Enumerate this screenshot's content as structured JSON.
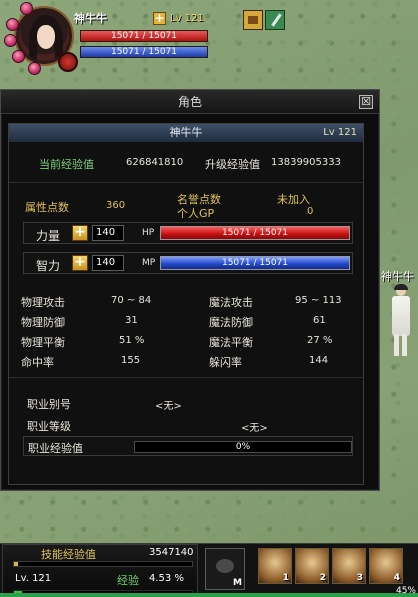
{
  "player": {
    "name": "神牛牛",
    "level": "Lv 121",
    "hp": "15071 / 15071",
    "mp": "15071 / 15071"
  },
  "panel": {
    "title": "角色",
    "close_glyph": "☒",
    "name": "神牛牛",
    "level": "Lv 121",
    "exp": {
      "current_label": "当前经验值",
      "current_value": "626841810",
      "upgrade_label": "升级经验值",
      "upgrade_value": "13839905333"
    },
    "points": {
      "attr_label": "属性点数",
      "attr_value": "360",
      "fame_label": "名誉点数",
      "fame_value": "未加入",
      "gp_label": "个人GP",
      "gp_value": "0"
    },
    "strength": {
      "label": "力量",
      "value": "140",
      "bar_label": "HP",
      "bar_value": "15071 / 15071"
    },
    "intelligence": {
      "label": "智力",
      "value": "140",
      "bar_label": "MP",
      "bar_value": "15071 / 15071"
    },
    "combat_stats": [
      {
        "label": "物理攻击",
        "value": "70 ~ 84",
        "label2": "魔法攻击",
        "value2": "95 ~ 113"
      },
      {
        "label": "物理防御",
        "value": "31",
        "label2": "魔法防御",
        "value2": "61"
      },
      {
        "label": "物理平衡",
        "value": "51 %",
        "label2": "魔法平衡",
        "value2": "27 %"
      },
      {
        "label": "命中率",
        "value": "155",
        "label2": "躲闪率",
        "value2": "144"
      }
    ],
    "job": {
      "alias_label": "职业别号",
      "alias_value": "<无>",
      "level_label": "职业等级",
      "level_value": "<无>",
      "exp_label": "职业经验值",
      "exp_value": "0%"
    }
  },
  "other_player": {
    "name": "神牛牛"
  },
  "hud": {
    "skill_exp_label": "技能经验值",
    "skill_exp_value": "3547140",
    "skill_exp_fraction": 0.02,
    "level": "Lv. 121",
    "exp_label": "经验",
    "exp_percent": "4.53 %",
    "exp_fraction": 0.0453,
    "mount_key": "M",
    "skill_slots": [
      {
        "key": "1",
        "icon": "warrior-skill-icon"
      },
      {
        "key": "2",
        "icon": "slash-skill-icon"
      },
      {
        "key": "3",
        "icon": "whirl-skill-icon"
      },
      {
        "key": "4",
        "icon": "guard-skill-icon"
      }
    ],
    "corner_percent": "45%"
  }
}
